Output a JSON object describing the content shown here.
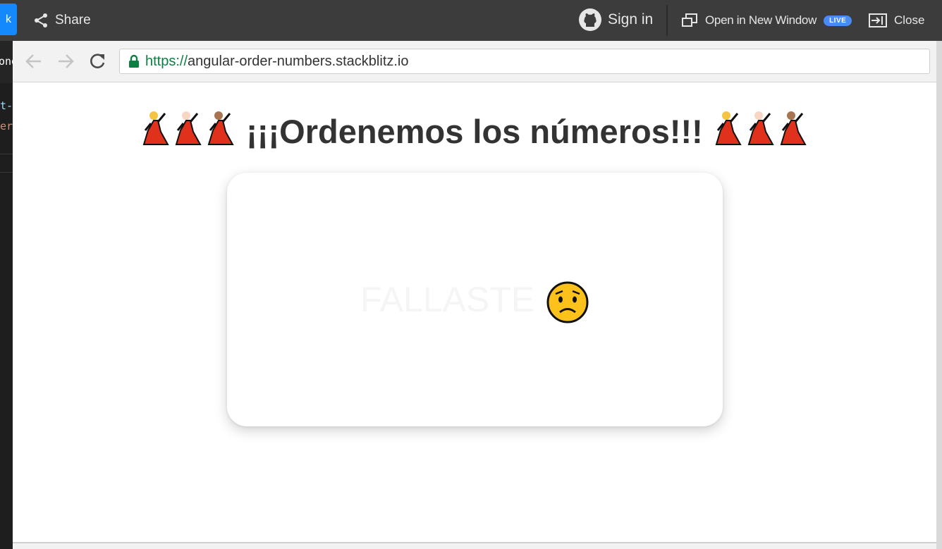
{
  "topbar": {
    "fork_label": "k",
    "share_label": "Share",
    "signin_label": "Sign in",
    "open_new_window_label": "Open in New Window",
    "live_badge": "LIVE",
    "close_label": "Close"
  },
  "editor": {
    "tab_text": "one",
    "code_line_1": "t-",
    "code_line_2": "er"
  },
  "browser": {
    "url_scheme": "https://",
    "url_host": "angular-order-numbers.stackblitz.io"
  },
  "page": {
    "heading_text": "¡¡¡Ordenemos los números!!!",
    "result_text": "FALLASTE"
  },
  "colors": {
    "topbar_bg": "#3c3c3c",
    "accent_blue": "#1389fd",
    "live_badge": "#4a8af4",
    "secure_green": "#0b8043",
    "heading": "#333333"
  },
  "icons": [
    "share-icon",
    "github-icon",
    "open-window-icon",
    "close-panel-icon",
    "back-arrow-icon",
    "forward-arrow-icon",
    "reload-icon",
    "lock-icon",
    "dancer-emoji",
    "worried-face-emoji"
  ]
}
